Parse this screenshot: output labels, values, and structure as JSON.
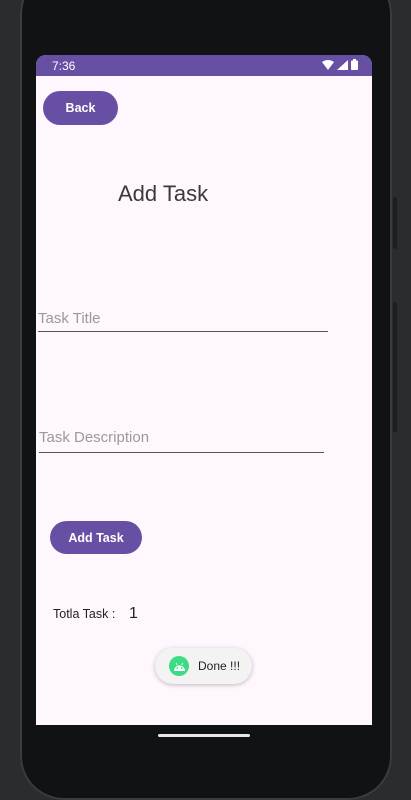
{
  "status_bar": {
    "time": "7:36",
    "icons": [
      "wifi-icon",
      "cellular-signal-icon",
      "battery-icon"
    ],
    "background": "#6750a4"
  },
  "back_button": {
    "label": "Back"
  },
  "page_title": "Add Task",
  "task_title_field": {
    "placeholder": "Task Title",
    "value": ""
  },
  "task_description_field": {
    "placeholder": "Task Description",
    "value": ""
  },
  "add_task_button": {
    "label": "Add Task"
  },
  "total": {
    "label": "Totla Task :",
    "value": "1"
  },
  "toast": {
    "icon": "android-icon",
    "text": "Done !!!"
  },
  "colors": {
    "accent": "#6750a4",
    "screen_bg": "#fef7fd",
    "toast_icon": "#3ddc84"
  }
}
